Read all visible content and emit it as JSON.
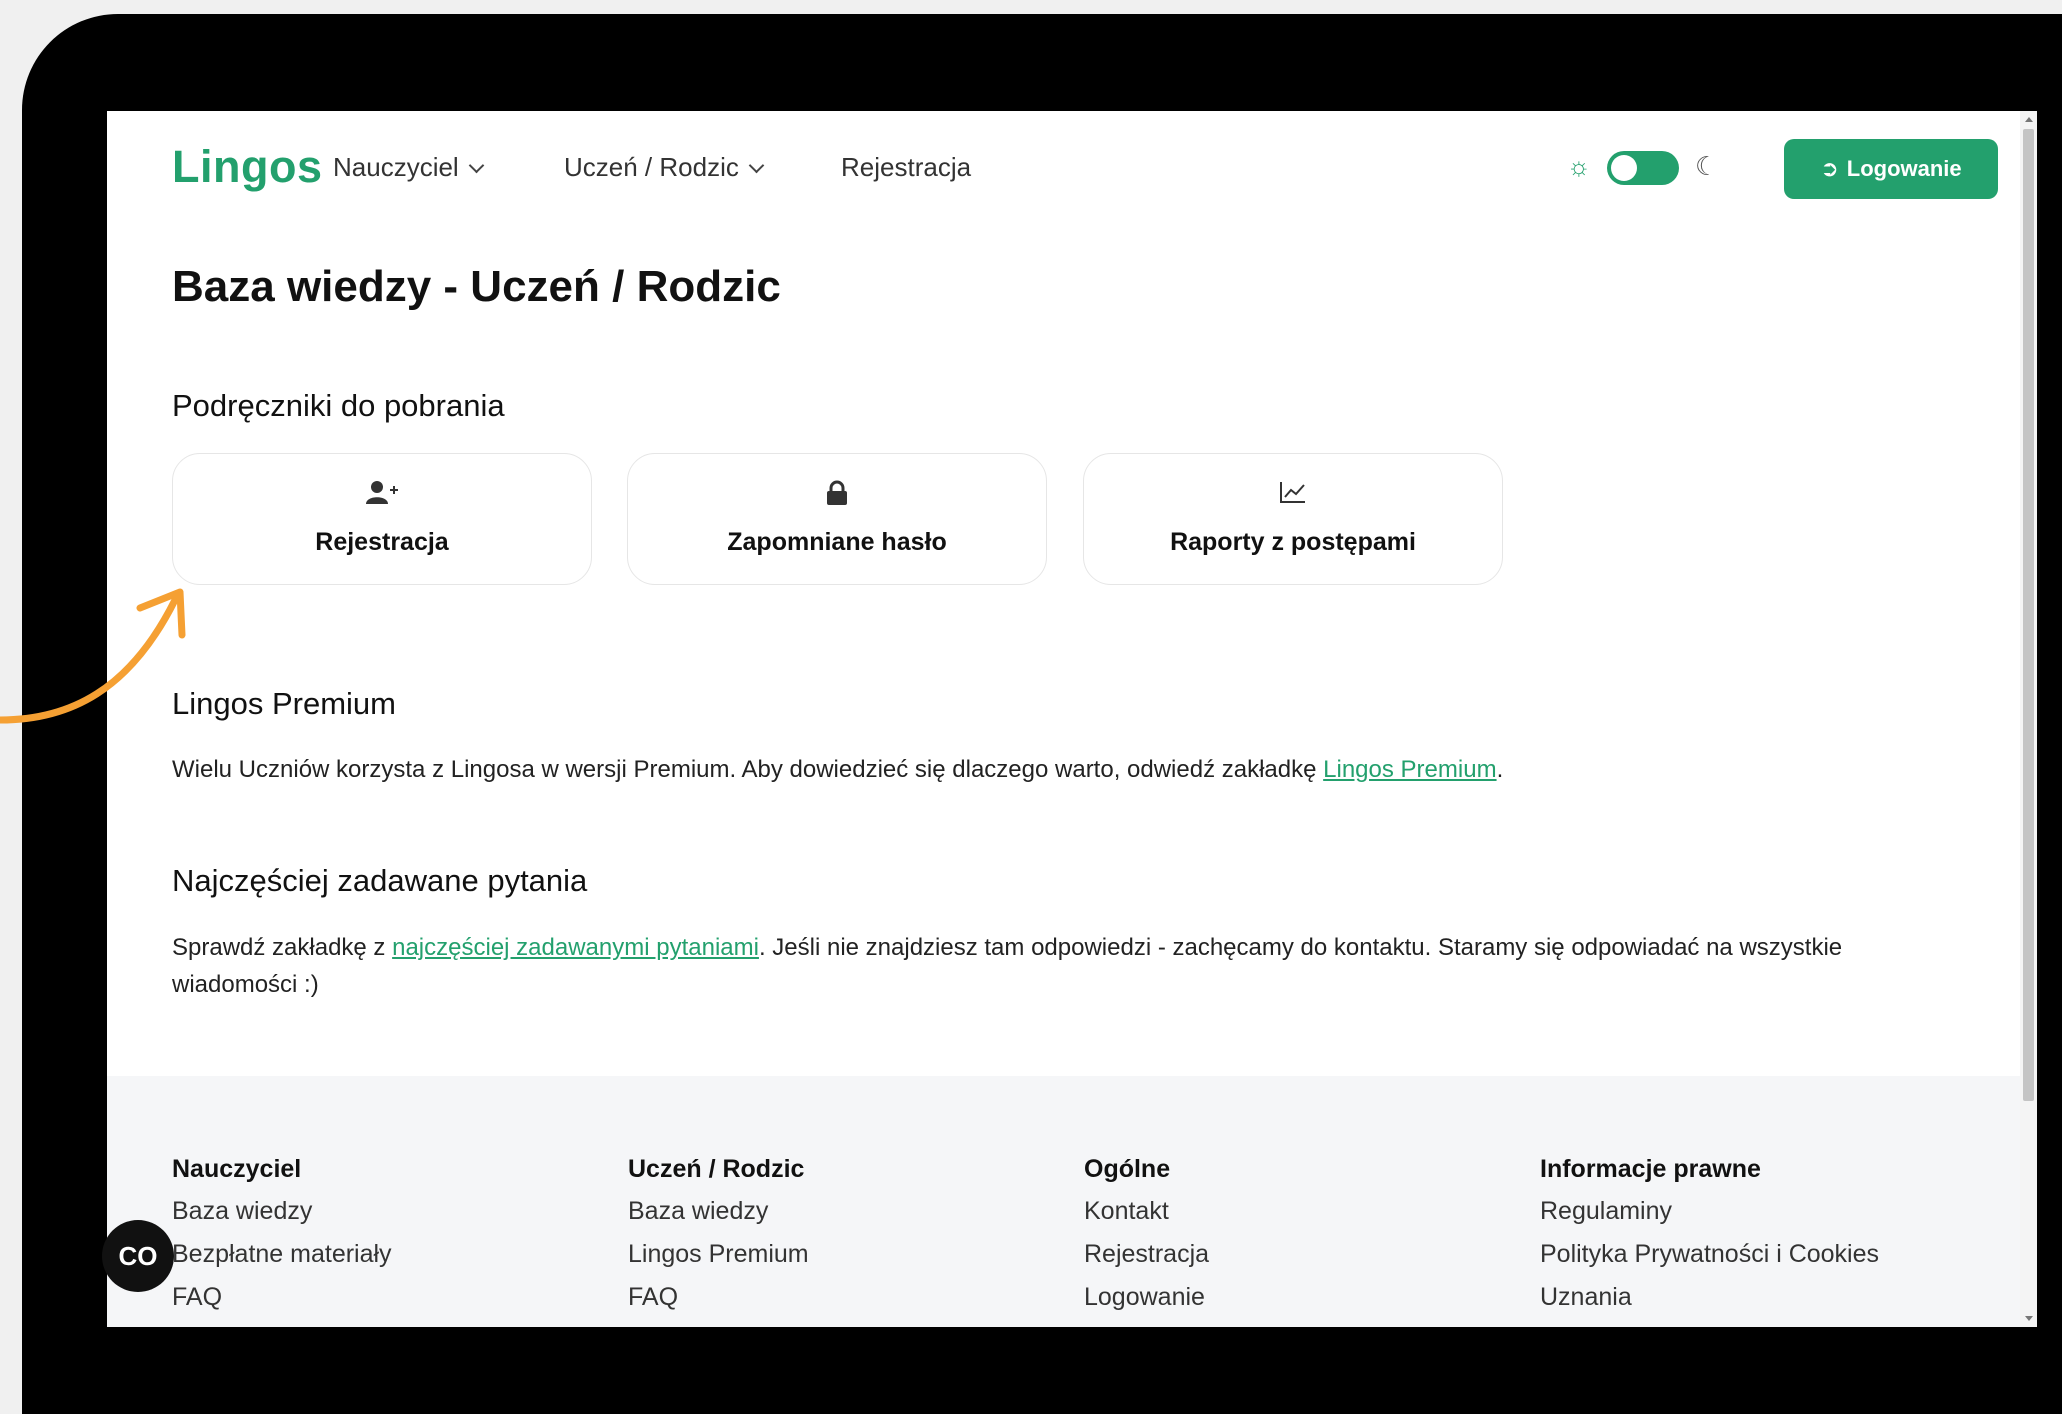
{
  "header": {
    "logo": "Lingos",
    "nav": [
      {
        "label": "Nauczyciel",
        "has_dropdown": true
      },
      {
        "label": "Uczeń / Rodzic",
        "has_dropdown": true
      },
      {
        "label": "Rejestracja",
        "has_dropdown": false
      }
    ],
    "theme_toggle": {
      "sun_icon": "sun-icon",
      "moon_icon": "moon-icon",
      "state": "light"
    },
    "login_label": "Logowanie"
  },
  "main": {
    "title": "Baza wiedzy - Uczeń / Rodzic",
    "manuals": {
      "heading": "Podręczniki do pobrania",
      "cards": [
        {
          "label": "Rejestracja",
          "icon": "user-plus-icon"
        },
        {
          "label": "Zapomniane hasło",
          "icon": "lock-icon"
        },
        {
          "label": "Raporty z postępami",
          "icon": "chart-line-icon"
        }
      ]
    },
    "premium": {
      "heading": "Lingos Premium",
      "text_before": "Wielu Uczniów korzysta z Lingosa w wersji Premium. Aby dowiedzieć się dlaczego warto, odwiedź zakładkę ",
      "link": "Lingos Premium",
      "text_after": "."
    },
    "faq": {
      "heading": "Najczęściej zadawane pytania",
      "text_before": "Sprawdź zakładkę z ",
      "link": "najczęściej zadawanymi pytaniami",
      "text_after": ". Jeśli nie znajdziesz tam odpowiedzi - zachęcamy do kontaktu. Staramy się odpowiadać na wszystkie wiadomości :)"
    }
  },
  "footer": {
    "columns": [
      {
        "heading": "Nauczyciel",
        "links": [
          "Baza wiedzy",
          "Bezpłatne materiały",
          "FAQ"
        ]
      },
      {
        "heading": "Uczeń / Rodzic",
        "links": [
          "Baza wiedzy",
          "Lingos Premium",
          "FAQ"
        ]
      },
      {
        "heading": "Ogólne",
        "links": [
          "Kontakt",
          "Rejestracja",
          "Logowanie"
        ]
      },
      {
        "heading": "Informacje prawne",
        "links": [
          "Regulaminy",
          "Polityka Prywatności i Cookies",
          "Uznania"
        ]
      }
    ]
  },
  "colors": {
    "accent": "#23a06d",
    "annotation_arrow": "#f5a033",
    "frame": "#000000"
  },
  "floating": {
    "accessibility_button": "CO"
  }
}
